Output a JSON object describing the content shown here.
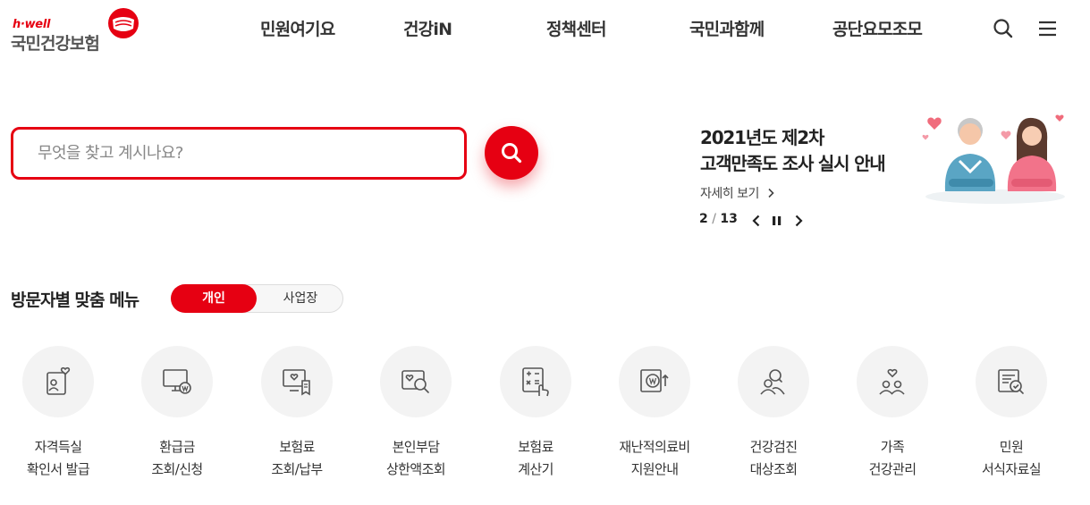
{
  "header": {
    "logo_tagline": "h·well",
    "logo_name": "국민건강보험",
    "nav": [
      "민원여기요",
      "건강iN",
      "정책센터",
      "국민과함께",
      "공단요모조모"
    ]
  },
  "search": {
    "placeholder": "무엇을 찾고 계시나요?"
  },
  "banner": {
    "title_line1": "2021년도 제2차",
    "title_line2": "고객만족도 조사 실시 안내",
    "more_label": "자세히 보기",
    "current": "2",
    "separator": "/",
    "total": "13"
  },
  "visitor_menu": {
    "title": "방문자별 맞춤 메뉴",
    "tabs": [
      "개인",
      "사업장"
    ],
    "active_tab": "개인",
    "items": [
      {
        "line1": "자격득실",
        "line2": "확인서 발급",
        "icon": "id-card-heart-icon"
      },
      {
        "line1": "환급금",
        "line2": "조회/신청",
        "icon": "monitor-won-icon"
      },
      {
        "line1": "보험료",
        "line2": "조회/납부",
        "icon": "monitor-heart-receipt-icon"
      },
      {
        "line1": "본인부담",
        "line2": "상한액조회",
        "icon": "heart-search-icon"
      },
      {
        "line1": "보험료",
        "line2": "계산기",
        "icon": "calculator-hand-icon"
      },
      {
        "line1": "재난적의료비",
        "line2": "지원안내",
        "icon": "won-arrow-up-icon"
      },
      {
        "line1": "건강검진",
        "line2": "대상조회",
        "icon": "people-search-icon"
      },
      {
        "line1": "가족",
        "line2": "건강관리",
        "icon": "family-heart-icon"
      },
      {
        "line1": "민원",
        "line2": "서식자료실",
        "icon": "document-check-icon"
      }
    ]
  },
  "colors": {
    "brand_red": "#e60012",
    "icon_gray": "#555555",
    "circle_bg": "#f3f3f3"
  }
}
